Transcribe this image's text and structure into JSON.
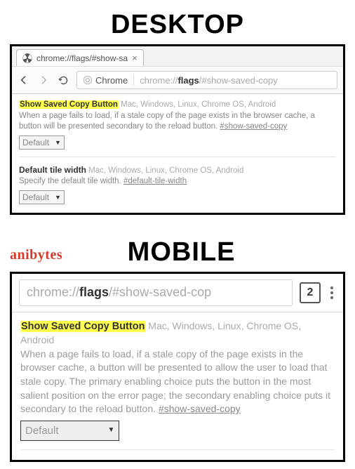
{
  "heading_desktop": "DESKTOP",
  "heading_mobile": "MOBILE",
  "brand": "anibytes",
  "desktop": {
    "tab_title": "chrome://flags/#show-sa",
    "url_prefix": "chrome://",
    "url_bold": "flags",
    "url_suffix": "/#show-saved-copy",
    "chrome_label": "Chrome",
    "flag1": {
      "title": "Show Saved Copy Button",
      "platforms": " Mac, Windows, Linux, Chrome OS, Android",
      "desc": "When a page fails to load, if a stale copy of the page exists in the browser cache, a button will be presented secondary to the reload button. ",
      "hash": "#show-saved-copy",
      "select": "Default"
    },
    "flag2": {
      "title": "Default tile width",
      "platforms": " Mac, Windows, Linux, Chrome OS, Android",
      "desc": "Specify the default tile width. ",
      "hash": "#default-tile-width",
      "select": "Default"
    }
  },
  "mobile": {
    "url_prefix": "chrome://",
    "url_bold": "flags",
    "url_suffix": "/#show-saved-cop",
    "tab_count": "2",
    "flag1": {
      "title": "Show Saved Copy Button",
      "platforms": " Mac, Windows, Linux, Chrome OS, Android",
      "desc": "When a page fails to load, if a stale copy of the page exists in the browser cache, a button will be presented to allow the user to load that stale copy. The primary enabling choice puts the button in the most salient position on the error page; the secondary enabling choice puts it secondary to the reload button. ",
      "hash": "#show-saved-copy",
      "select": "Default"
    }
  }
}
